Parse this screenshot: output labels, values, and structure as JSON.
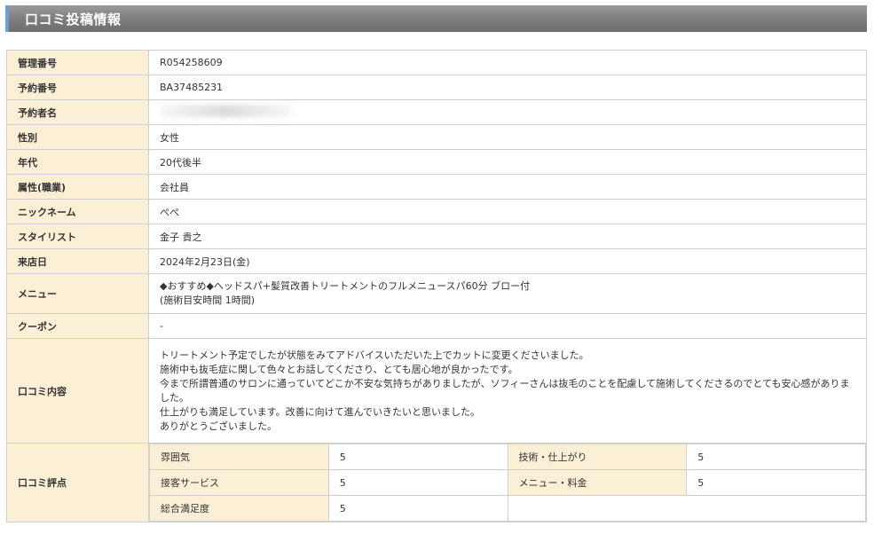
{
  "header": {
    "title": "口コミ投稿情報"
  },
  "rows": {
    "management_no": {
      "label": "管理番号",
      "value": "R054258609"
    },
    "reservation_no": {
      "label": "予約番号",
      "value": "BA37485231"
    },
    "reserver_name": {
      "label": "予約者名",
      "value": ""
    },
    "gender": {
      "label": "性別",
      "value": "女性"
    },
    "age": {
      "label": "年代",
      "value": "20代後半"
    },
    "occupation": {
      "label": "属性(職業)",
      "value": "会社員"
    },
    "nickname": {
      "label": "ニックネーム",
      "value": "ぺぺ"
    },
    "stylist": {
      "label": "スタイリスト",
      "value": "金子 貴之"
    },
    "visit_date": {
      "label": "来店日",
      "value": "2024年2月23日(金)"
    },
    "menu": {
      "label": "メニュー",
      "lines": [
        "◆おすすめ◆ヘッドスパ+髪質改善トリートメントのフルメニュースパ60分 ブロー付",
        "(施術目安時間 1時間)"
      ]
    },
    "coupon": {
      "label": "クーポン",
      "value": "-"
    },
    "review": {
      "label": "口コミ内容",
      "lines": [
        "トリートメント予定でしたが状態をみてアドバイスいただいた上でカットに変更くださいました。",
        "施術中も抜毛症に関して色々とお話してくださり、とても居心地が良かったです。",
        "今まで所謂普通のサロンに通っていてどこか不安な気持ちがありましたが、ソフィーさんは抜毛のことを配慮して施術してくださるのでとても安心感がありました。",
        "仕上がりも満足しています。改善に向けて進んでいきたいと思いました。",
        "ありがとうございました。"
      ]
    },
    "rating": {
      "label": "口コミ評点",
      "items": [
        {
          "label": "雰囲気",
          "value": "5"
        },
        {
          "label": "技術・仕上がり",
          "value": "5"
        },
        {
          "label": "接客サービス",
          "value": "5"
        },
        {
          "label": "メニュー・料金",
          "value": "5"
        },
        {
          "label": "総合満足度",
          "value": "5"
        }
      ]
    }
  }
}
